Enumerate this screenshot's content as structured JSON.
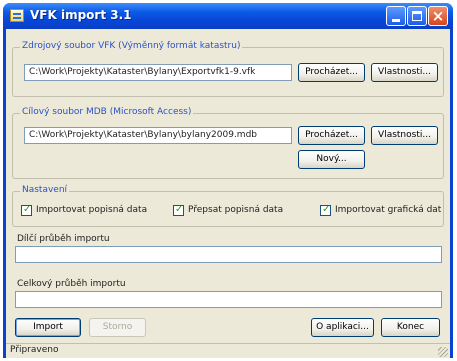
{
  "window": {
    "title": "VFK import 3.1"
  },
  "source_group": {
    "label": "Zdrojový soubor VFK (Výměnný formát katastru)",
    "path": "C:\\Work\\Projekty\\Kataster\\Bylany\\Exportvfk1-9.vfk",
    "browse_label": "Procházet...",
    "properties_label": "Vlastnosti..."
  },
  "target_group": {
    "label": "Cílový soubor MDB (Microsoft Access)",
    "path": "C:\\Work\\Projekty\\Kataster\\Bylany\\bylany2009.mdb",
    "browse_label": "Procházet...",
    "properties_label": "Vlastnosti...",
    "new_label": "Nový..."
  },
  "settings_group": {
    "label": "Nastavení",
    "options": [
      {
        "label": "Importovat popisná data",
        "checked": true
      },
      {
        "label": "Přepsat popisná data",
        "checked": true
      },
      {
        "label": "Importovat grafická dat",
        "checked": true
      }
    ]
  },
  "progress": {
    "partial_label": "Dílčí průběh importu",
    "partial_value": 0,
    "total_label": "Celkový průběh importu",
    "total_value": 0
  },
  "buttons": {
    "import_label": "Import",
    "stop_label": "Storno",
    "about_label": "O aplikaci...",
    "exit_label": "Konec"
  },
  "status": {
    "text": "Připraveno"
  }
}
